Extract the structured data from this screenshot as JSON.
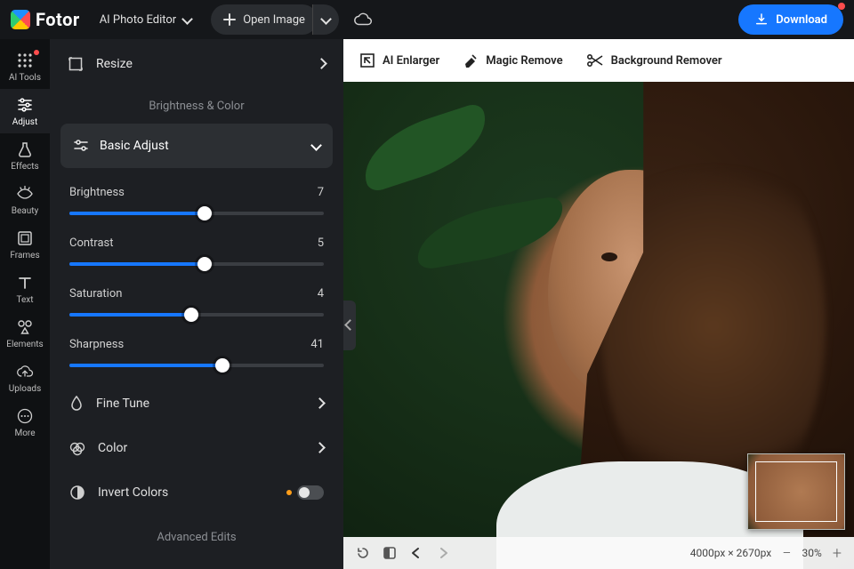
{
  "header": {
    "brand": "Fotor",
    "editor_mode": "AI Photo Editor",
    "open_image": "Open Image",
    "download": "Download"
  },
  "rail": {
    "items": [
      {
        "id": "ai-tools",
        "label": "AI Tools"
      },
      {
        "id": "adjust",
        "label": "Adjust"
      },
      {
        "id": "effects",
        "label": "Effects"
      },
      {
        "id": "beauty",
        "label": "Beauty"
      },
      {
        "id": "frames",
        "label": "Frames"
      },
      {
        "id": "text",
        "label": "Text"
      },
      {
        "id": "elements",
        "label": "Elements"
      },
      {
        "id": "uploads",
        "label": "Uploads"
      },
      {
        "id": "more",
        "label": "More"
      }
    ],
    "active": "adjust"
  },
  "panel": {
    "resize": "Resize",
    "section_brightness_color": "Brightness & Color",
    "basic_adjust": "Basic Adjust",
    "sliders": [
      {
        "id": "brightness",
        "label": "Brightness",
        "value": 7,
        "pct": 53
      },
      {
        "id": "contrast",
        "label": "Contrast",
        "value": 5,
        "pct": 53
      },
      {
        "id": "saturation",
        "label": "Saturation",
        "value": 4,
        "pct": 48
      },
      {
        "id": "sharpness",
        "label": "Sharpness",
        "value": 41,
        "pct": 60
      }
    ],
    "fine_tune": "Fine Tune",
    "color": "Color",
    "invert_colors": "Invert Colors",
    "invert_colors_on": false,
    "section_advanced": "Advanced Edits"
  },
  "tools": {
    "ai_enlarger": "AI Enlarger",
    "magic_remove": "Magic Remove",
    "background_remover": "Background Remover"
  },
  "bottom": {
    "dimensions": "4000px × 2670px",
    "zoom": "30%"
  },
  "colors": {
    "accent": "#1677ff",
    "panel_bg": "#1d1f23",
    "rail_bg": "#0f1113"
  }
}
